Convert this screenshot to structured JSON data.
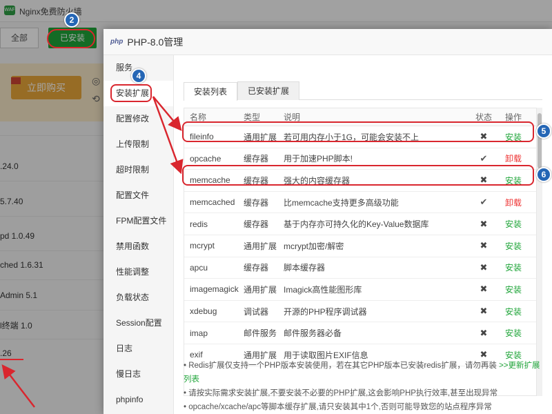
{
  "background_app": {
    "title": "Nginx免费防火墙",
    "tabs": [
      "全部",
      "已安装"
    ],
    "buy_button": "立即购买",
    "rows": [
      ".24.0",
      "5.7.40",
      "pd 1.0.49",
      "ched 1.6.31",
      "Admin 5.1",
      "l终端 1.0",
      ".26"
    ]
  },
  "dialog": {
    "icon": "php",
    "title": "PHP-8.0管理",
    "sidebar": [
      "服务",
      "安装扩展",
      "配置修改",
      "上传限制",
      "超时限制",
      "配置文件",
      "FPM配置文件",
      "禁用函数",
      "性能调整",
      "负载状态",
      "Session配置",
      "日志",
      "慢日志",
      "phpinfo"
    ],
    "tabs": [
      "安装列表",
      "已安装扩展"
    ],
    "table": {
      "headers": [
        "名称",
        "类型",
        "说明",
        "状态",
        "操作"
      ],
      "rows": [
        {
          "name": "fileinfo",
          "type": "通用扩展",
          "desc": "若可用内存小于1G，可能会安装不上",
          "installed": false,
          "op": "安装"
        },
        {
          "name": "opcache",
          "type": "缓存器",
          "desc": "用于加速PHP脚本!",
          "installed": true,
          "op": "卸载"
        },
        {
          "name": "memcache",
          "type": "缓存器",
          "desc": "强大的内容缓存器",
          "installed": false,
          "op": "安装"
        },
        {
          "name": "memcached",
          "type": "缓存器",
          "desc": "比memcache支持更多高级功能",
          "installed": true,
          "op": "卸载"
        },
        {
          "name": "redis",
          "type": "缓存器",
          "desc": "基于内存亦可持久化的Key-Value数据库",
          "installed": false,
          "op": "安装"
        },
        {
          "name": "mcrypt",
          "type": "通用扩展",
          "desc": "mcrypt加密/解密",
          "installed": false,
          "op": "安装"
        },
        {
          "name": "apcu",
          "type": "缓存器",
          "desc": "脚本缓存器",
          "installed": false,
          "op": "安装"
        },
        {
          "name": "imagemagick",
          "type": "通用扩展",
          "desc": "Imagick高性能图形库",
          "installed": false,
          "op": "安装"
        },
        {
          "name": "xdebug",
          "type": "调试器",
          "desc": "开源的PHP程序调试器",
          "installed": false,
          "op": "安装"
        },
        {
          "name": "imap",
          "type": "邮件服务",
          "desc": "邮件服务器必备",
          "installed": false,
          "op": "安装"
        },
        {
          "name": "exif",
          "type": "通用扩展",
          "desc": "用于读取图片EXIF信息",
          "installed": false,
          "op": "安装"
        }
      ]
    },
    "notes": {
      "note1": "Redis扩展仅支持一个PHP版本安装使用，若在其它PHP版本已安装redis扩展，请勿再装",
      "note1_link": ">>更新扩展列表",
      "note2": "请按实际需求安装扩展,不要安装不必要的PHP扩展,这会影响PHP执行效率,甚至出现异常",
      "note3": "opcache/xcache/apc等脚本缓存扩展,请只安装其中1个,否则可能导致您的站点程序异常"
    }
  },
  "annotations": [
    "2",
    "4",
    "5",
    "6"
  ],
  "colors": {
    "accent": "#20a53a",
    "danger": "#e33333",
    "annotation_red": "#d9262e",
    "badge_blue": "#2566b5"
  }
}
